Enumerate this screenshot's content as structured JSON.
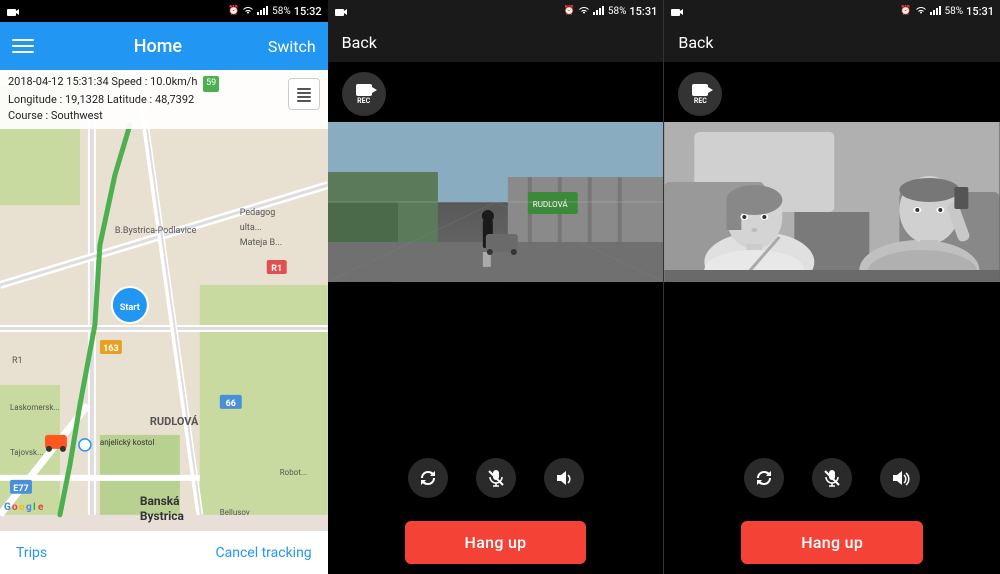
{
  "panel1": {
    "statusBar": {
      "icons": "alarm wifi signal battery",
      "battery": "58%",
      "time": "15:32"
    },
    "appBar": {
      "title": "Home",
      "switchLabel": "Switch"
    },
    "infoBar": {
      "datetime": "2018-04-12  15:31:34",
      "speed": "Speed : 10.0km/h",
      "speedBadge": "59",
      "longitude": "Longitude : 19,1328",
      "latitude": "Latitude : 48,7392",
      "course": "Course : Southwest"
    },
    "layerBtn": "⊞",
    "bottomBar": {
      "tripsLabel": "Trips",
      "cancelLabel": "Cancel tracking"
    }
  },
  "panel2": {
    "statusBar": {
      "camIcon": "📹",
      "battery": "58%",
      "time": "15:31"
    },
    "header": {
      "backLabel": "Back"
    },
    "recLabel": "REC",
    "controls": {
      "rotateLabel": "↻",
      "micLabel": "🎙",
      "speakerLabel": "🔊"
    },
    "hangUp": "Hang up"
  },
  "panel3": {
    "statusBar": {
      "camIcon": "📹",
      "battery": "58%",
      "time": "15:31"
    },
    "header": {
      "backLabel": "Back"
    },
    "recLabel": "REC",
    "controls": {
      "rotateLabel": "↻",
      "micLabel": "🎙",
      "speakerLabel": "🔊"
    },
    "hangUp": "Hang up"
  }
}
